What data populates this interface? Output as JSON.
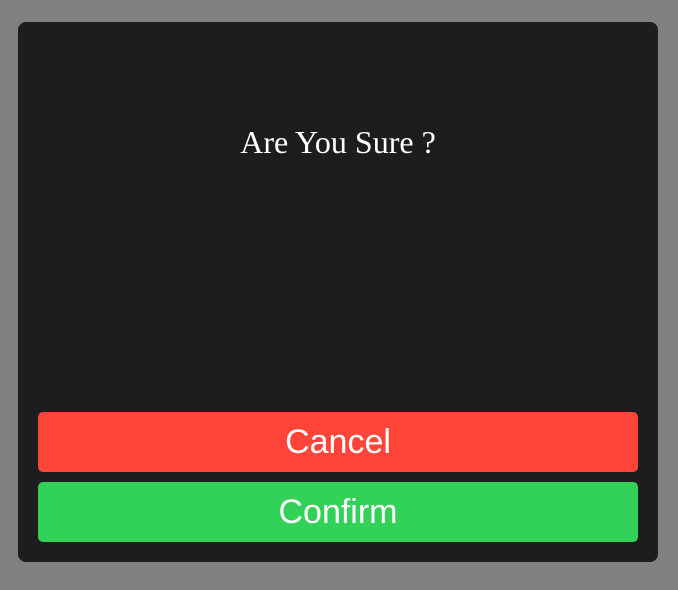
{
  "dialog": {
    "title": "Are You Sure ?",
    "cancel_label": "Cancel",
    "confirm_label": "Confirm"
  },
  "colors": {
    "backdrop": "#808080",
    "dialog_background": "#1d1d1f",
    "cancel": "#ff453a",
    "confirm": "#32d158",
    "text": "#ffffff"
  }
}
